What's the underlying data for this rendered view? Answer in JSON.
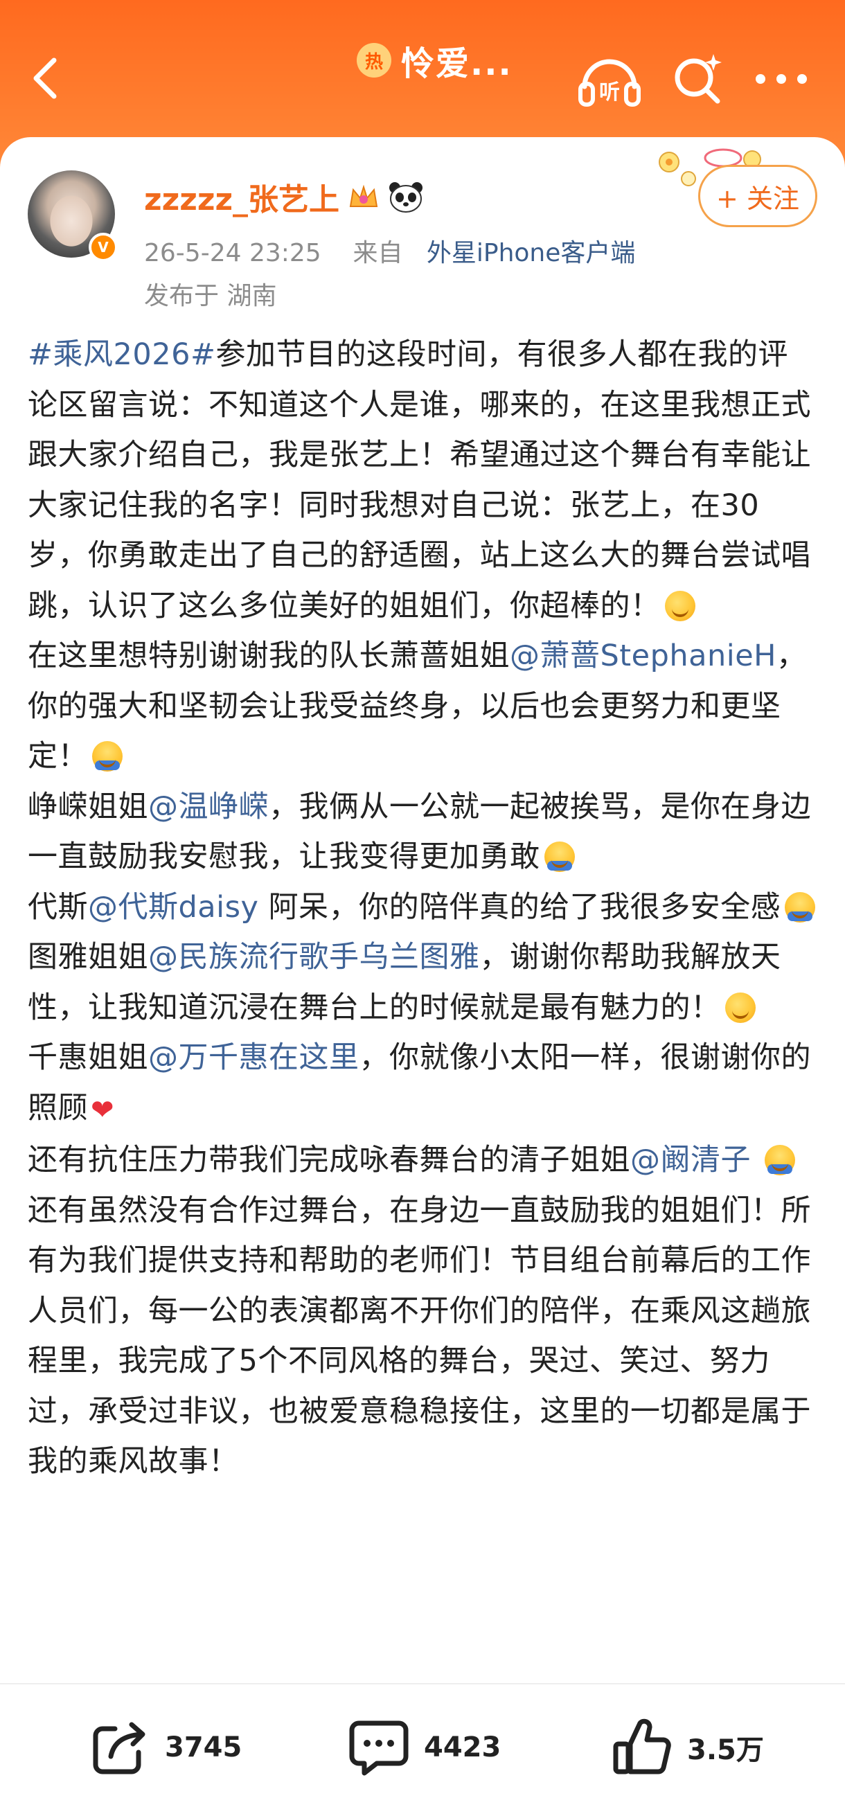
{
  "topbar": {
    "hot_badge": "热",
    "title": "怜爱...",
    "listen_label": "听",
    "icons": [
      "back-arrow-icon",
      "listen-headphones-icon",
      "search-sparkle-icon",
      "more-dots-icon"
    ]
  },
  "post": {
    "username": "zzzzz_张艺上",
    "follow_label": "+ 关注",
    "time": "26-5-24 23:25",
    "from_label": "来自",
    "client": "外星iPhone客户端",
    "location": "发布于 湖南",
    "paragraphs": [
      {
        "segments": [
          {
            "type": "link",
            "text": "#乘风2026#"
          },
          {
            "type": "text",
            "text": "参加节目的这段时间，有很多人都在我的评论区留言说：不知道这个人是谁，哪来的，在这里我想正式跟大家介绍自己，我是张艺上！希望通过这个舞台有幸能让大家记住我的名字！同时我想对自己说：张艺上，在30岁，你勇敢走出了自己的舒适圈，站上这么大的舞台尝试唱跳，认识了这么多位美好的姐姐们，你超棒的！"
          },
          {
            "type": "emoji",
            "name": "blush-emoji"
          }
        ]
      },
      {
        "segments": [
          {
            "type": "text",
            "text": "在这里想特别谢谢我的队长萧蔷姐姐"
          },
          {
            "type": "link",
            "text": "@萧蔷StephanieH"
          },
          {
            "type": "text",
            "text": "，你的强大和坚韧会让我受益终身，以后也会更努力和更坚定！"
          },
          {
            "type": "emoji",
            "name": "hug-emoji"
          }
        ]
      },
      {
        "segments": [
          {
            "type": "text",
            "text": "峥嵘姐姐"
          },
          {
            "type": "link",
            "text": "@温峥嵘"
          },
          {
            "type": "text",
            "text": "，我俩从一公就一起被挨骂，是你在身边一直鼓励我安慰我，让我变得更加勇敢"
          },
          {
            "type": "emoji",
            "name": "hug-emoji"
          }
        ]
      },
      {
        "segments": [
          {
            "type": "text",
            "text": "代斯"
          },
          {
            "type": "link",
            "text": "@代斯daisy"
          },
          {
            "type": "text",
            "text": " 阿呆，你的陪伴真的给了我很多安全感"
          },
          {
            "type": "emoji",
            "name": "hug-emoji"
          }
        ]
      },
      {
        "segments": [
          {
            "type": "text",
            "text": "图雅姐姐"
          },
          {
            "type": "link",
            "text": "@民族流行歌手乌兰图雅"
          },
          {
            "type": "text",
            "text": "，谢谢你帮助我解放天性，让我知道沉浸在舞台上的时候就是最有魅力的！"
          },
          {
            "type": "emoji",
            "name": "surprised-emoji"
          }
        ]
      },
      {
        "segments": [
          {
            "type": "text",
            "text": "千惠姐姐"
          },
          {
            "type": "link",
            "text": "@万千惠在这里"
          },
          {
            "type": "text",
            "text": "，你就像小太阳一样，很谢谢你的照顾"
          },
          {
            "type": "heart",
            "text": "❤"
          }
        ]
      },
      {
        "segments": [
          {
            "type": "text",
            "text": "还有抗住压力带我们完成咏春舞台的清子姐姐"
          },
          {
            "type": "link",
            "text": "@阚清子"
          },
          {
            "type": "text",
            "text": " "
          },
          {
            "type": "emoji",
            "name": "hug-emoji"
          }
        ]
      },
      {
        "segments": [
          {
            "type": "text",
            "text": "还有虽然没有合作过舞台，在身边一直鼓励我的姐姐们！所有为我们提供支持和帮助的老师们！节目组台前幕后的工作人员们，每一公的表演都离不开你们的陪伴，在乘风这趟旅程里，我完成了5个不同风格的舞台，哭过、笑过、努力过，承受过非议，也被爱意稳稳接住，这里的一切都是属于我的乘风故事！"
          }
        ]
      }
    ]
  },
  "actions": {
    "share_count": "3745",
    "comment_count": "4423",
    "like_count": "3.5万"
  },
  "colors": {
    "header_orange": "#ff7a2e",
    "username_orange": "#f06a1c",
    "link_blue": "#3f6397",
    "meta_gray": "#8c8c8c"
  }
}
